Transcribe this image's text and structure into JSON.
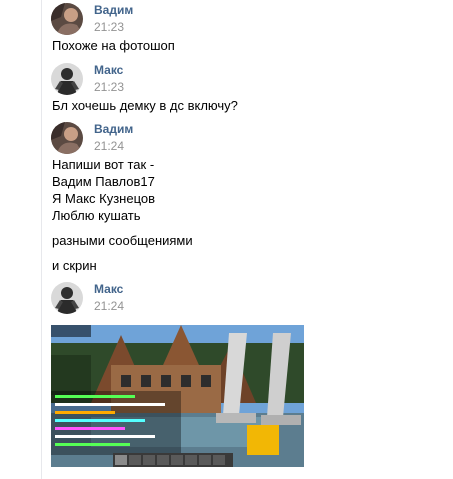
{
  "messages": [
    {
      "author": "Вадим",
      "time": "21:23",
      "lines": [
        "Похоже на фотошоп"
      ]
    },
    {
      "author": "Макс",
      "time": "21:23",
      "lines": [
        "Бл хочешь демку в дс включу?"
      ]
    },
    {
      "author": "Вадим",
      "time": "21:24",
      "lines": [
        "Напиши вот так -",
        "Вадим Павлов17",
        "Я Макс Кузнецов",
        "Люблю кушать"
      ],
      "extra_lines": [
        "разными сообщениями",
        "и скрин"
      ]
    },
    {
      "author": "Макс",
      "time": "21:24",
      "attachment": "game-screenshot"
    }
  ],
  "colors": {
    "author": "#42648b",
    "time": "#939393",
    "text": "#000000",
    "divider": "#e7e8ec"
  },
  "icons": {
    "vadim_avatar": "photo-avatar-vadim",
    "maks_avatar": "photo-avatar-maks"
  }
}
